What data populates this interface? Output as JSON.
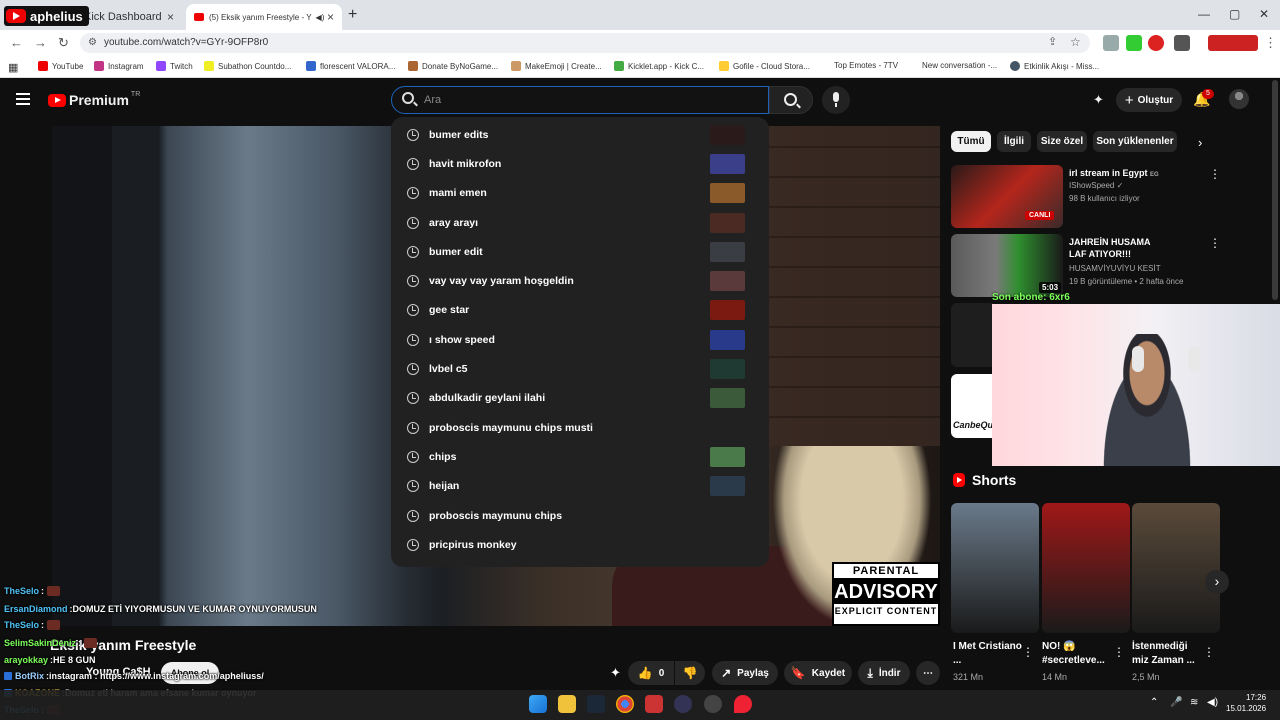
{
  "browser": {
    "tabs": [
      {
        "title": "Kick Dashboard",
        "close": "×"
      },
      {
        "title": "(5) Eksik yanım Freestyle - Y",
        "close": "×"
      }
    ],
    "new_tab": "+",
    "window_controls": [
      "—",
      "▢",
      "✕"
    ],
    "address": "youtube.com/watch?v=GYr-9OFP8r0",
    "bookmarks": [
      "YouTube",
      "Instagram",
      "Twitch",
      "Subathon Countdo...",
      "florescent VALORA...",
      "Donate ByNoGame...",
      "MakeEmoji | Create...",
      "Kicklet.app - Kick C...",
      "Gofile - Cloud Stora...",
      "Top Emotes - 7TV",
      "New conversation -...",
      "Etkinlik Akışı - Miss..."
    ]
  },
  "overlay": {
    "brand": "aphelius",
    "sub_goal": "Son abone: 6xr6",
    "webcam_caption": "CanbeQu"
  },
  "header": {
    "logo": "Premium",
    "region": "TR",
    "search_placeholder": "Ara",
    "create_label": "Oluştur",
    "notification_count": "5"
  },
  "suggestions": [
    {
      "text": "bumer edits",
      "thumb": "#2a1a1a"
    },
    {
      "text": "havit mikrofon",
      "thumb": "#3b3f8a"
    },
    {
      "text": "mami emen",
      "thumb": "#8a5a2a"
    },
    {
      "text": "aray arayı",
      "thumb": "#4a2a22"
    },
    {
      "text": "bumer edit",
      "thumb": "#3a3d44"
    },
    {
      "text": "vay vay vay yaram hoşgeldin",
      "thumb": "#5a3a3a"
    },
    {
      "text": "gee star",
      "thumb": "#7a1a10"
    },
    {
      "text": "ı show speed",
      "thumb": "#2a3a8a"
    },
    {
      "text": "lvbel c5",
      "thumb": "#1e3a32"
    },
    {
      "text": "abdulkadir geylani ilahi",
      "thumb": "#3a5a3a"
    },
    {
      "text": "proboscis maymunu chips musti",
      "thumb": ""
    },
    {
      "text": "chips",
      "thumb": "#4a7a4a"
    },
    {
      "text": "heijan",
      "thumb": "#2a3a4a"
    },
    {
      "text": "proboscis maymunu chips",
      "thumb": ""
    },
    {
      "text": "pricpirus monkey",
      "thumb": ""
    }
  ],
  "advisory": {
    "line1": "PARENTAL",
    "line2": "ADVISORY",
    "line3": "EXPLICIT CONTENT"
  },
  "chips": [
    "Tümü",
    "İlgili",
    "Size özel",
    "Son yüklenenler"
  ],
  "recommendations": [
    {
      "title": "irl stream in Egypt",
      "title_suffix": "EG",
      "channel": "IShowSpeed ✓",
      "meta": "98 B kullanıcı izliyor",
      "badge": "CANLI"
    },
    {
      "title": "JAHREİN HUSAMA LAF ATIYOR!!!",
      "channel": "HUSAMVİYUVİYU KESİT",
      "meta": "19 B görüntüleme • 2 hafta önce",
      "badge": "5:03"
    }
  ],
  "shorts": {
    "heading": "Shorts",
    "items": [
      {
        "title": "I Met Cristiano ...",
        "views": "321 Mn",
        "color": "#6a7a8a"
      },
      {
        "title": "NO! 😱 #secretleve...",
        "views": "14 Mn",
        "color": "#a01818"
      },
      {
        "title": "İstenmediği miz Zaman ...",
        "views": "2,5 Mn",
        "color": "#5a4a3a"
      }
    ]
  },
  "video": {
    "title": "Eksik yanım Freestyle",
    "channel": "Young Ca$H",
    "subscribe": "Abone ol",
    "likes": "0",
    "share": "Paylaş",
    "save": "Kaydet",
    "download": "İndir"
  },
  "chat": [
    {
      "user": "TheSelo",
      "text": "",
      "color": "#4fc3f7",
      "emote": true
    },
    {
      "user": "ErsanDiamond",
      "text": "DOMUZ ETİ YIYORMUSUN VE KUMAR OYNUYORMUSUN",
      "color": "#4fc3f7"
    },
    {
      "user": "TheSelo",
      "text": "",
      "color": "#4fc3f7",
      "emote": true
    },
    {
      "user": "SelimSakinDeniz",
      "text": "",
      "color": "#7cff5a",
      "emote": true
    },
    {
      "user": "arayokkay",
      "text": "HE 8 GUN",
      "color": "#7cff5a"
    },
    {
      "user": "BotRix",
      "text": "instagram : https://www.instagram.com/apheliuss/",
      "color": "#9ad0ff",
      "prefix": true
    },
    {
      "user": "KOAZONE",
      "text": "Domuz eti haram ama efsane kumar oynuyor",
      "color": "#ffd54f",
      "prefix": true
    },
    {
      "user": "TheSelo",
      "text": "",
      "color": "#4fc3f7",
      "emote": true
    }
  ],
  "clock": {
    "time": "17:26",
    "date": "15.01.2026"
  }
}
